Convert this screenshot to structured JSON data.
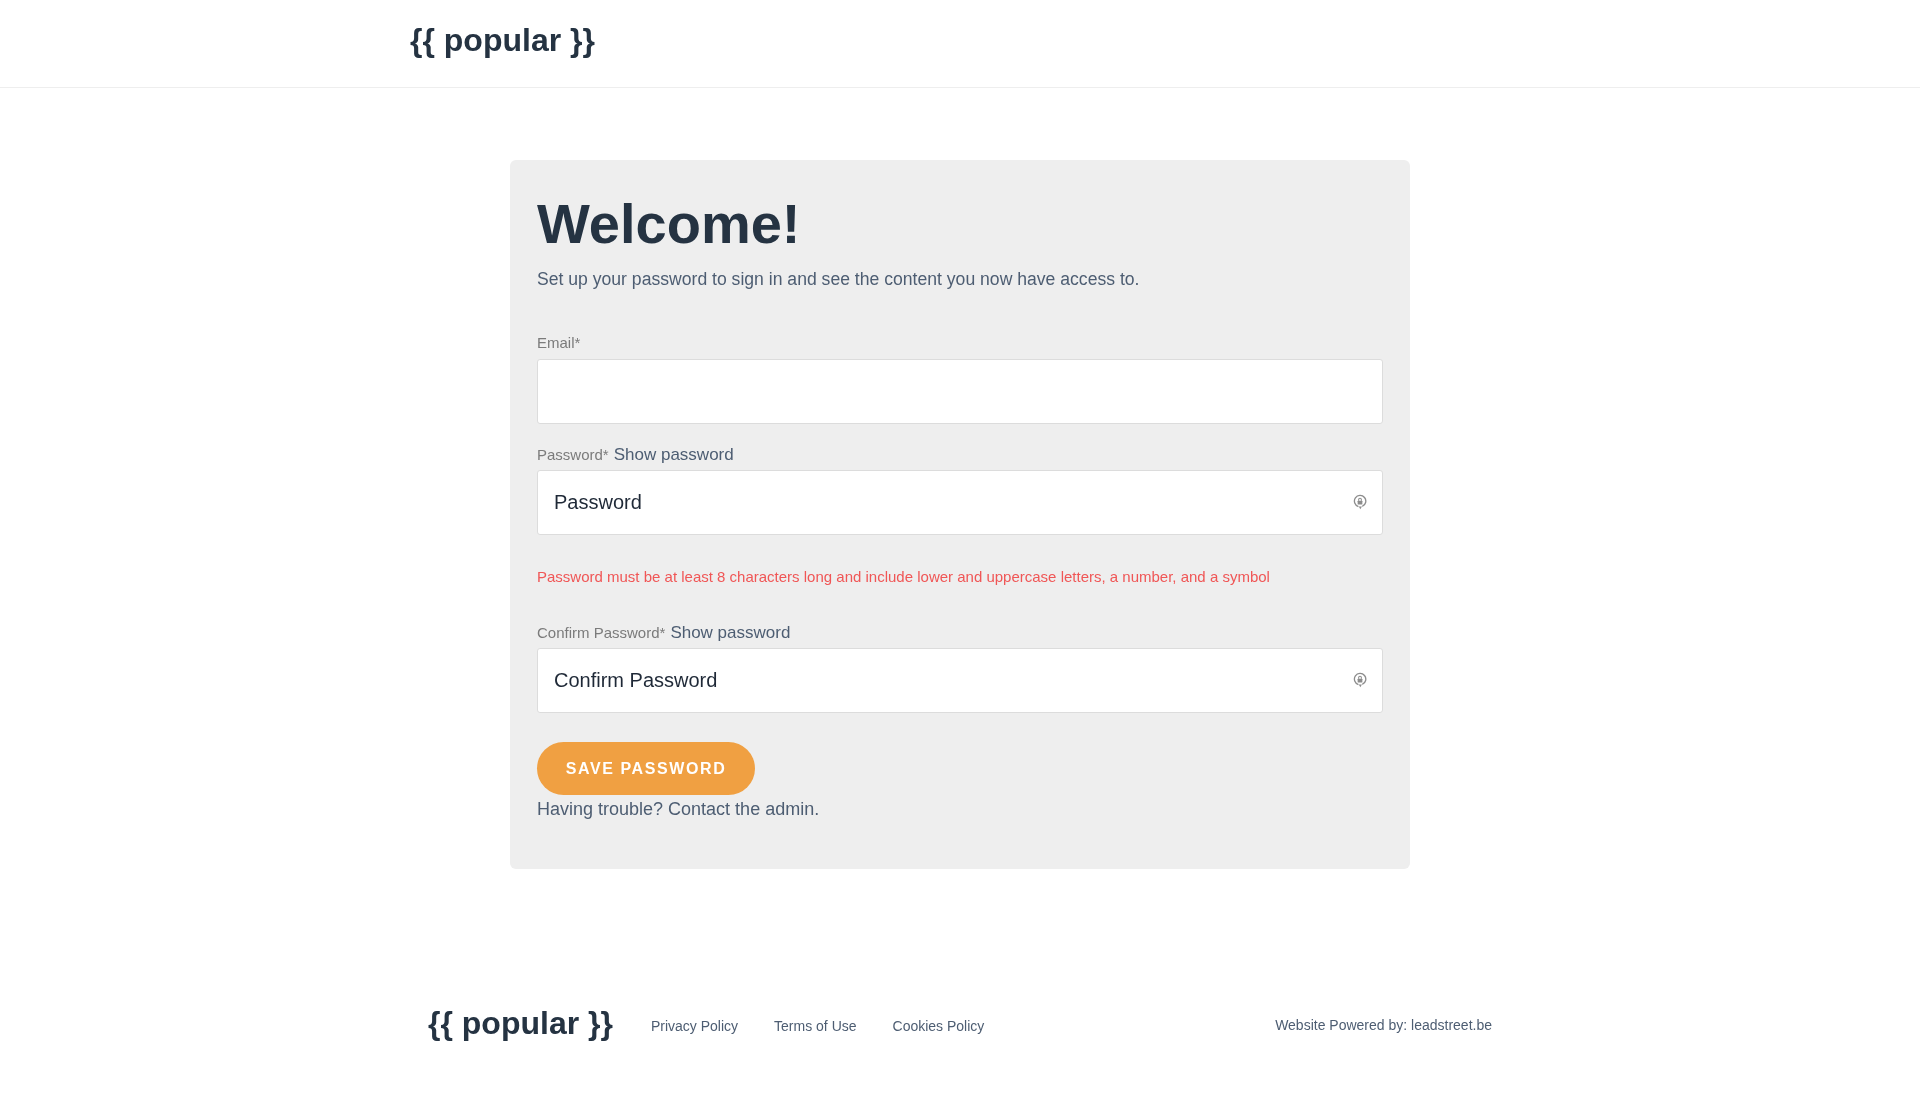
{
  "header": {
    "logo": "{{ popular }}"
  },
  "form": {
    "title": "Welcome!",
    "intro": "Set up your password to sign in and see the content you now have access to.",
    "fields": [
      {
        "kind": "email",
        "label": "Email*"
      },
      {
        "kind": "password",
        "label": "Password*",
        "toggle": "Show password",
        "placeholder": "Password",
        "error": "Password must be at least 8 characters long and include lower and uppercase letters, a number, and a symbol"
      },
      {
        "kind": "password",
        "label": "Confirm Password*",
        "toggle": "Show password",
        "placeholder": "Confirm Password"
      }
    ],
    "submit": "SAVE PASSWORD",
    "help": "Having trouble? Contact the admin."
  },
  "footer": {
    "logo": "{{ popular }}",
    "links": [
      "Privacy Policy",
      "Terms of Use",
      "Cookies Policy"
    ],
    "credit": "Website Powered by: leadstreet.be"
  }
}
